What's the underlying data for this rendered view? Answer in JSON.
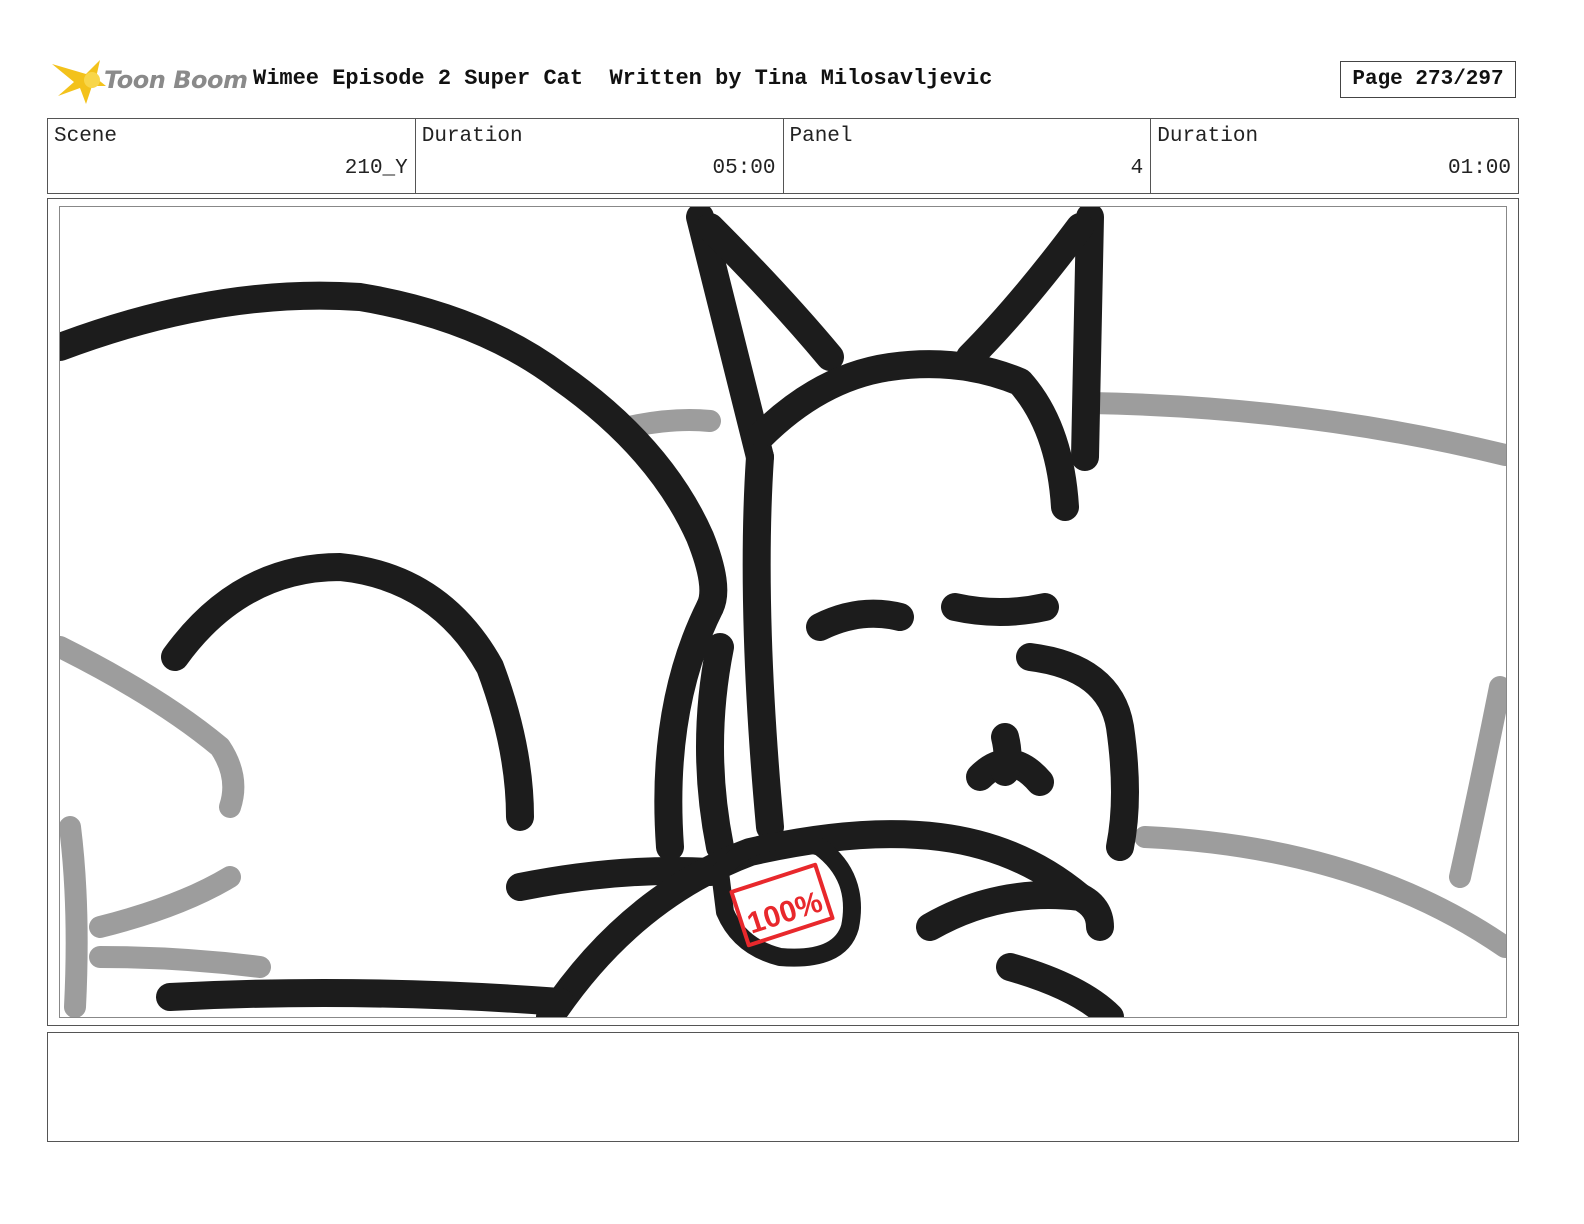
{
  "header": {
    "logo_text": "Toon Boom",
    "title": "Wimee Episode 2 Super Cat  Written by Tina Milosavljevic",
    "page": "Page 273/297"
  },
  "info": {
    "scene_label": "Scene",
    "scene_value": "210_Y",
    "scene_duration_label": "Duration",
    "scene_duration_value": "05:00",
    "panel_label": "Panel",
    "panel_value": "4",
    "panel_duration_label": "Duration",
    "panel_duration_value": "01:00"
  },
  "panel": {
    "tag_text": "100%"
  },
  "colors": {
    "ink": "#1c1c1c",
    "gray_ink": "#8c8c8c",
    "tag_red": "#e8282c",
    "logo_gold": "#f3c21b",
    "logo_text": "#8a8a8a"
  },
  "notes": {
    "text": ""
  }
}
